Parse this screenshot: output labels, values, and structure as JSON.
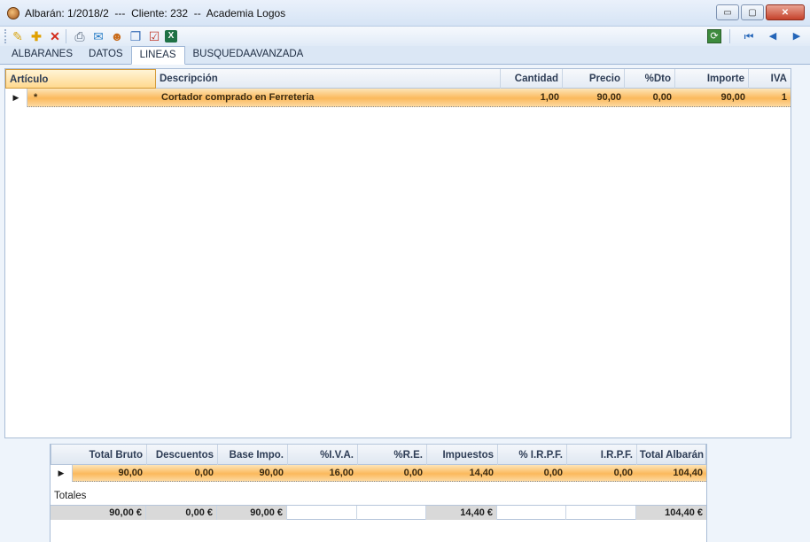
{
  "window": {
    "title": "Albarán: 1/2018/2  ---  Cliente: 232  --  Academia Logos",
    "buttons": {
      "minimize": "▭",
      "maximize": "▢",
      "close": "✕"
    }
  },
  "toolbar": {
    "icons": [
      "edit-icon",
      "add-icon",
      "delete-icon",
      "print-icon",
      "email-icon",
      "contact-icon",
      "window-icon",
      "checklist-icon",
      "excel-icon"
    ],
    "nav_icons": [
      "refresh-icon",
      "first-record-icon",
      "previous-record-icon",
      "next-record-icon"
    ]
  },
  "tabs": [
    {
      "label": "ALBARANES",
      "active": false
    },
    {
      "label": "DATOS",
      "active": false
    },
    {
      "label": "LINEAS",
      "active": true
    },
    {
      "label": "BUSQUEDAAVANZADA",
      "active": false
    }
  ],
  "lines_grid": {
    "columns": [
      "Artículo",
      "Descripción",
      "Cantidad",
      "Precio",
      "%Dto",
      "Importe",
      "IVA"
    ],
    "rows": [
      {
        "articulo": "*",
        "descripcion": "Cortador comprado en Ferreteria",
        "cantidad": "1,00",
        "precio": "90,00",
        "dto": "0,00",
        "importe": "90,00",
        "iva": "1"
      }
    ]
  },
  "totals_grid": {
    "columns": [
      "Total Bruto",
      "Descuentos",
      "Base Impo.",
      "%I.V.A.",
      "%R.E.",
      "Impuestos",
      "% I.R.P.F.",
      "I.R.P.F.",
      "Total Albarán"
    ],
    "row": [
      "90,00",
      "0,00",
      "90,00",
      "16,00",
      "0,00",
      "14,40",
      "0,00",
      "0,00",
      "104,40"
    ],
    "summary_label": "Totales",
    "summary": [
      "90,00 €",
      "0,00 €",
      "90,00 €",
      "",
      "",
      "14,40 €",
      "",
      "",
      "104,40 €"
    ]
  },
  "colors": {
    "row_highlight": "#fbb95c",
    "header": "#e4ebf4",
    "accent": "#d49b3a"
  }
}
